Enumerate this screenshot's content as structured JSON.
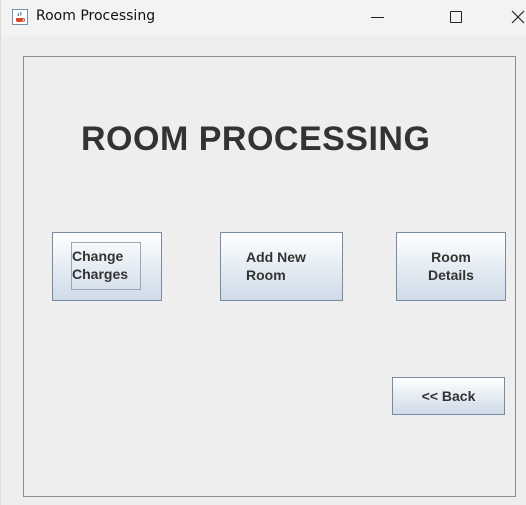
{
  "window": {
    "title": "Room Processing",
    "app_icon": "java-coffee-cup-icon",
    "controls": {
      "minimize": "minimize-icon",
      "maximize": "maximize-icon",
      "close": "close-icon"
    }
  },
  "panel": {
    "heading": "ROOM PROCESSING",
    "buttons": {
      "change_charges": "Change\nCharges",
      "add_new_room": "Add New\nRoom",
      "room_details": "Room\nDetails",
      "back": "<< Back"
    }
  },
  "colors": {
    "window_bg": "#eeeeee",
    "heading_text": "#333333",
    "button_border": "#7a8a9e",
    "button_gradient_bottom": "#cfdbe8"
  }
}
